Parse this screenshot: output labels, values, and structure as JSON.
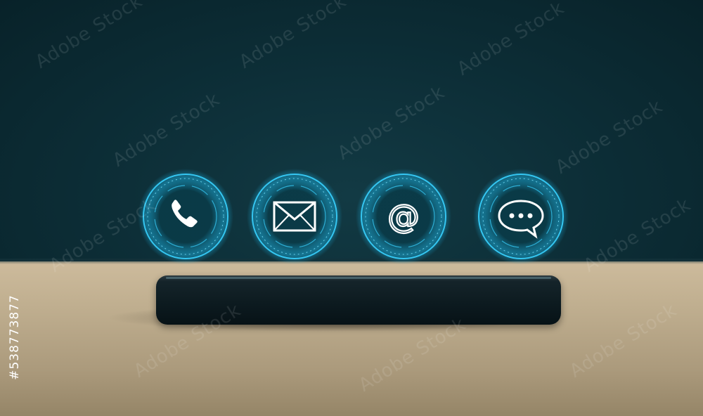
{
  "image": {
    "icons": [
      "phone-icon",
      "envelope-icon",
      "at-sign-icon",
      "chat-bubble-icon"
    ],
    "at_symbol": "@",
    "accent_color": "#39d2ff",
    "watermark_text": "Adobe Stock",
    "stock_id": "#538773877"
  }
}
